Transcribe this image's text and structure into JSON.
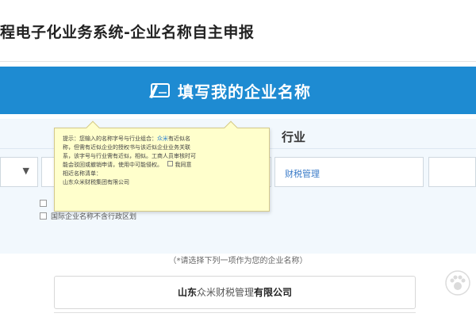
{
  "header": {
    "title": "程电子化业务系统-企业名称自主申报"
  },
  "banner": {
    "icon": "pencil-document-icon",
    "title": "填写我的企业名称",
    "bg_color": "#1e8bd2"
  },
  "form": {
    "industry_label": "行业",
    "select_arrow": "▼",
    "industry_value": "财税管理",
    "checkbox_2_label": "国际企业名称不含行政区划"
  },
  "tooltip": {
    "line1": "提示：您输入的名称字号与行业组合：",
    "line1_highlight": "众米",
    "line1_end": "有近似名",
    "line2": "称，但需有近似企业的授权书与该近似企业业务关联",
    "line3": "系，该字号与行业需有近似，相似。工商人员审核时可",
    "line4": "能会驳回或撤销申请，使用中可能侵权。",
    "line4_end": "我同意",
    "line5": "相近名称清单：",
    "line6": "山东众米财税集团有限公司"
  },
  "instruction": "（*请选择下列一项作为您的企业名称）",
  "result": {
    "part1": "山东",
    "part2": "众米财税管理",
    "part3": "有限公司"
  },
  "colors": {
    "accent": "#1e8bd2",
    "highlight": "#2a7fd0",
    "tooltip_bg": "#ffffcc"
  }
}
